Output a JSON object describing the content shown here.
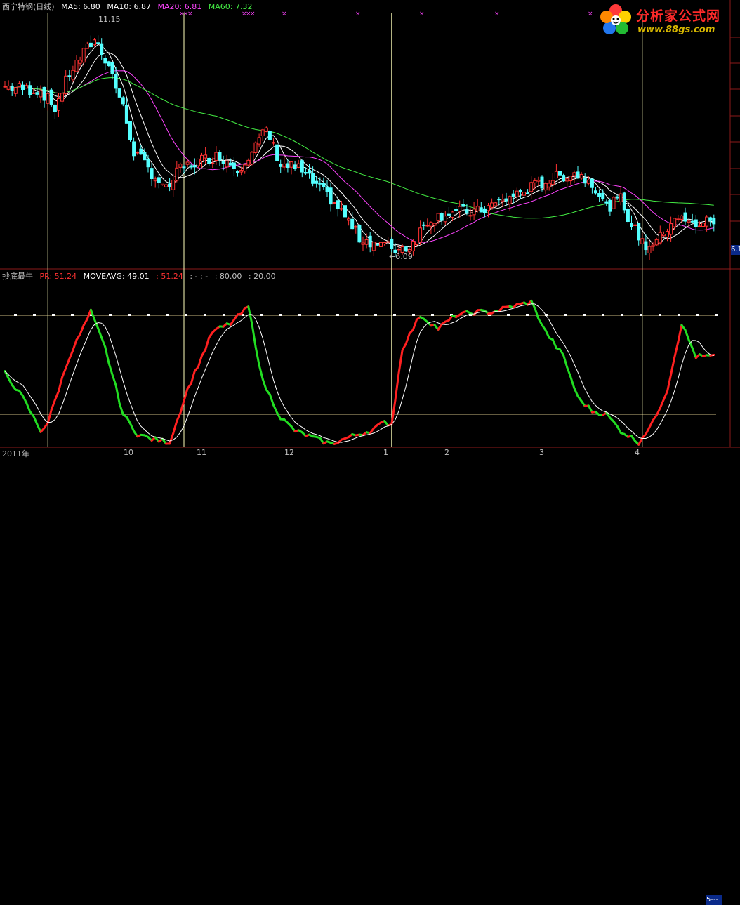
{
  "legend": {
    "stock_name": "西宁特钢(日线)",
    "ma5": {
      "label": "MA5: 6.80",
      "color": "#ffffff"
    },
    "ma10": {
      "label": "MA10: 6.87",
      "color": "#ffffff"
    },
    "ma20": {
      "label": "MA20: 6.81",
      "color": "#ff44ff"
    },
    "ma60": {
      "label": "MA60: 7.32",
      "color": "#44ee44"
    }
  },
  "indicator_legend": {
    "name": "抄底最牛",
    "pr": {
      "label": "PR: 51.24",
      "color": "#ff3333"
    },
    "moveavg": {
      "label": "MOVEAVG: 49.01",
      "color": "#ffffff"
    },
    "extra1": {
      "label": ": 51.24",
      "color": "#ff3333"
    },
    "extra2": {
      "label": ": - : -",
      "color": "#c0c0c0"
    },
    "extra3": {
      "label": ": 80.00",
      "color": "#c0c0c0"
    },
    "extra4": {
      "label": ": 20.00",
      "color": "#c0c0c0"
    }
  },
  "logo": {
    "title": "分析家公式网",
    "url": "www.88gs.com"
  },
  "annotations": {
    "high": "11.15",
    "low": "←6.09",
    "price_tag": "6.1"
  },
  "date_axis": {
    "labels": [
      "2011年",
      "10",
      "11",
      "12",
      "1",
      "2",
      "3",
      "4",
      "5"
    ],
    "last": "5---"
  },
  "colors": {
    "up": "#ff3232",
    "down": "#54ffff",
    "ma5": "#ffffff",
    "ma10": "#ffffff",
    "ma20": "#ff44ff",
    "ma60": "#44ee44",
    "grid": "#8b1a1a",
    "marker": "#ff44ff",
    "pr_up": "#ff2020",
    "pr_down": "#22dd22"
  },
  "chart_data": [
    {
      "type": "candlestick",
      "title": "西宁特钢(日线)",
      "ylim": [
        5.7,
        11.6
      ],
      "annotations": [
        {
          "label": "11.15",
          "kind": "high"
        },
        {
          "label": "6.09",
          "kind": "low"
        }
      ],
      "anchors": [
        [
          0,
          9.9
        ],
        [
          10,
          9.8
        ],
        [
          14,
          9.4
        ],
        [
          18,
          10.2
        ],
        [
          25,
          11.0
        ],
        [
          29,
          10.4
        ],
        [
          33,
          9.4
        ],
        [
          36,
          8.4
        ],
        [
          40,
          8.0
        ],
        [
          45,
          7.5
        ],
        [
          49,
          8.0
        ],
        [
          55,
          8.2
        ],
        [
          60,
          8.3
        ],
        [
          65,
          8.0
        ],
        [
          69,
          8.4
        ],
        [
          73,
          8.9
        ],
        [
          77,
          8.1
        ],
        [
          82,
          8.0
        ],
        [
          87,
          7.6
        ],
        [
          91,
          7.3
        ],
        [
          95,
          6.9
        ],
        [
          99,
          6.4
        ],
        [
          103,
          6.3
        ],
        [
          109,
          6.15
        ],
        [
          113,
          6.2
        ],
        [
          118,
          6.8
        ],
        [
          124,
          7.0
        ],
        [
          132,
          7.0
        ],
        [
          140,
          7.3
        ],
        [
          148,
          7.6
        ],
        [
          154,
          7.8
        ],
        [
          159,
          7.9
        ],
        [
          164,
          7.7
        ],
        [
          168,
          7.1
        ],
        [
          172,
          7.3
        ],
        [
          175,
          6.7
        ],
        [
          179,
          6.2
        ],
        [
          183,
          6.4
        ],
        [
          187,
          6.9
        ],
        [
          192,
          6.7
        ],
        [
          197,
          6.8
        ]
      ],
      "vertical_lines": [
        12,
        50,
        108,
        178
      ]
    },
    {
      "type": "line",
      "title": "抄底最牛",
      "ylim": [
        0,
        100
      ],
      "reference_levels": [
        80,
        20
      ],
      "series": [
        {
          "name": "PR"
        },
        {
          "name": "MOVEAVG"
        }
      ],
      "anchors": [
        [
          0,
          45
        ],
        [
          5,
          30
        ],
        [
          10,
          10
        ],
        [
          12,
          15
        ],
        [
          18,
          55
        ],
        [
          24,
          82
        ],
        [
          28,
          60
        ],
        [
          33,
          20
        ],
        [
          37,
          8
        ],
        [
          41,
          5
        ],
        [
          46,
          3
        ],
        [
          51,
          35
        ],
        [
          58,
          70
        ],
        [
          63,
          75
        ],
        [
          68,
          85
        ],
        [
          72,
          40
        ],
        [
          77,
          18
        ],
        [
          81,
          10
        ],
        [
          87,
          5
        ],
        [
          91,
          2
        ],
        [
          96,
          6
        ],
        [
          102,
          10
        ],
        [
          106,
          15
        ],
        [
          108,
          14
        ],
        [
          111,
          60
        ],
        [
          116,
          80
        ],
        [
          121,
          72
        ],
        [
          126,
          80
        ],
        [
          132,
          82
        ],
        [
          136,
          82
        ],
        [
          141,
          85
        ],
        [
          147,
          88
        ],
        [
          151,
          70
        ],
        [
          156,
          55
        ],
        [
          160,
          30
        ],
        [
          164,
          22
        ],
        [
          168,
          20
        ],
        [
          172,
          10
        ],
        [
          177,
          3
        ],
        [
          181,
          15
        ],
        [
          185,
          35
        ],
        [
          189,
          75
        ],
        [
          193,
          55
        ],
        [
          197,
          55
        ]
      ]
    }
  ]
}
